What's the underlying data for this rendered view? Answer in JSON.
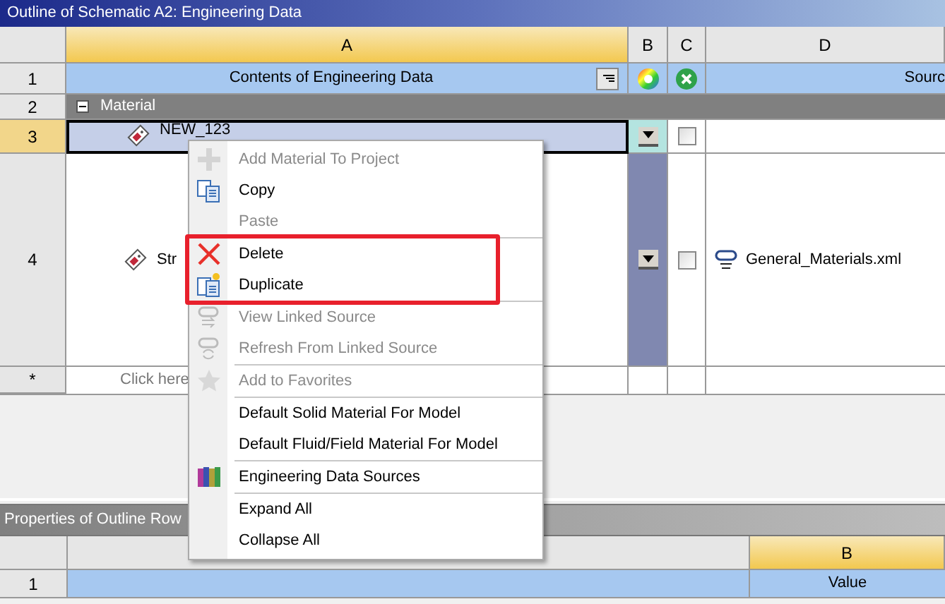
{
  "outline": {
    "title": "Outline of Schematic A2: Engineering Data",
    "columns": [
      "A",
      "B",
      "C",
      "D"
    ],
    "header_row": {
      "number": "1",
      "contents": "Contents of Engineering Data",
      "source": "Sourc"
    },
    "group": {
      "number": "2",
      "label": "Material",
      "expanded": true
    },
    "rows": [
      {
        "number": "3",
        "name": "NEW_123",
        "selected": true,
        "checked": false
      },
      {
        "number": "4",
        "name": "Str",
        "selected": false,
        "checked": false,
        "source": "General_Materials.xml"
      }
    ],
    "new_row": {
      "number": "*",
      "text": "Click here"
    }
  },
  "properties": {
    "title": "Properties of Outline Row",
    "column": "B",
    "row_number": "1",
    "value": "Value"
  },
  "context_menu": {
    "groups": [
      {
        "highlighted": false,
        "items": [
          {
            "label": "Add Material To Project",
            "disabled": true
          },
          {
            "label": "Copy",
            "disabled": false
          },
          {
            "label": "Paste",
            "disabled": true
          }
        ]
      },
      {
        "highlighted": true,
        "items": [
          {
            "label": "Delete",
            "disabled": false
          },
          {
            "label": "Duplicate",
            "disabled": false
          }
        ]
      },
      {
        "highlighted": false,
        "items": [
          {
            "label": "View Linked Source",
            "disabled": true
          },
          {
            "label": "Refresh From Linked Source",
            "disabled": true
          }
        ]
      },
      {
        "highlighted": false,
        "items": [
          {
            "label": "Add to Favorites",
            "disabled": true
          }
        ]
      },
      {
        "highlighted": false,
        "items": [
          {
            "label": "Default Solid Material For Model",
            "disabled": false
          },
          {
            "label": "Default Fluid/Field Material For Model",
            "disabled": false
          }
        ]
      },
      {
        "highlighted": false,
        "items": [
          {
            "label": "Engineering Data Sources",
            "disabled": false
          }
        ]
      },
      {
        "highlighted": false,
        "items": [
          {
            "label": "Expand All",
            "disabled": false
          },
          {
            "label": "Collapse All",
            "disabled": false
          }
        ]
      }
    ]
  }
}
